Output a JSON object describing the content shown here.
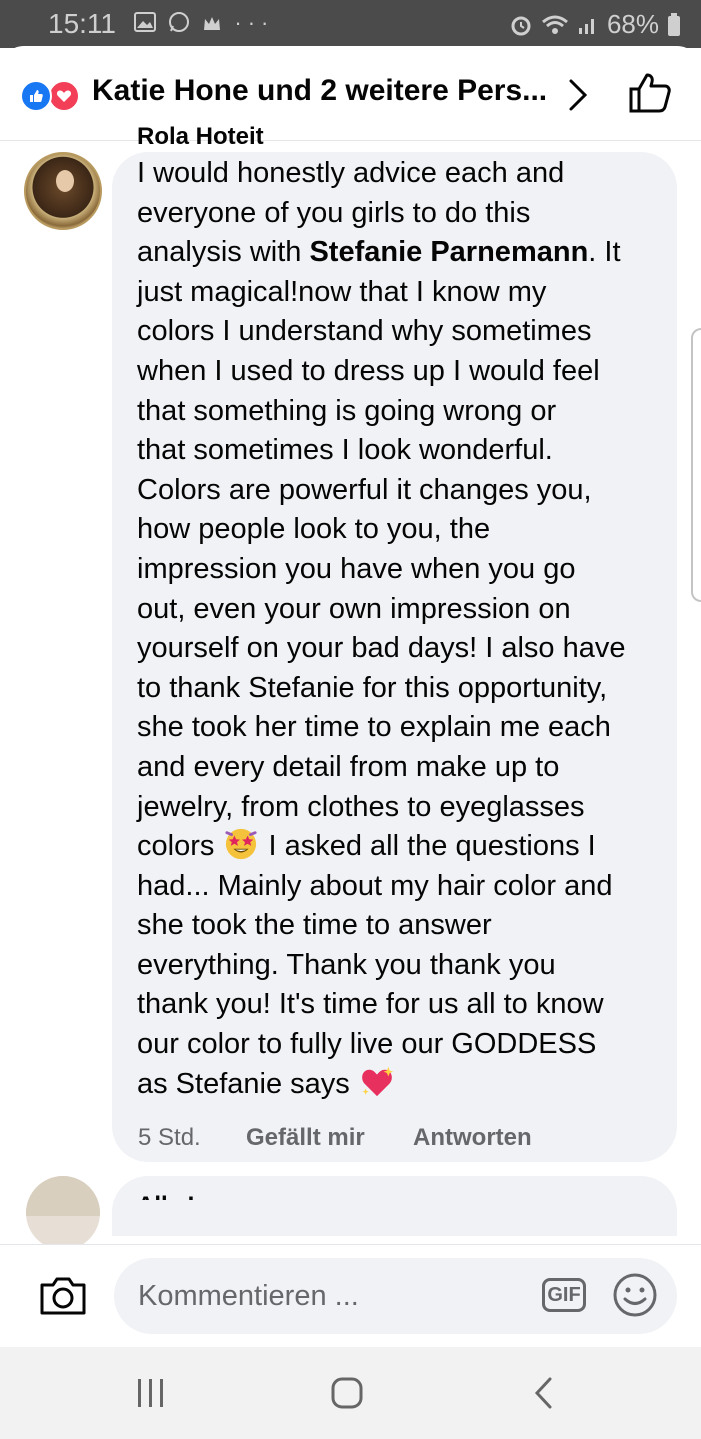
{
  "status_bar": {
    "time": "15:11",
    "left_icons": [
      "gallery-icon",
      "whatsapp-icon",
      "crown-icon",
      "more-icon"
    ],
    "battery": "68%"
  },
  "header": {
    "reactions": [
      "like",
      "love"
    ],
    "reactors_text": "Katie Hone und 2 weitere Pers...",
    "colors": {
      "like": "#1877f2",
      "love": "#f33e58"
    }
  },
  "comment": {
    "author": "Rola Hoteit",
    "lines": [
      "I would honestly advice each and",
      "everyone of you girls to do this",
      "analysis with ",
      "Stefanie Parnemann",
      ". It",
      "just magical!now that I know my",
      "colors I understand why sometimes",
      "when I used to dress up I would feel",
      "that something is going wrong or",
      "that sometimes I look wonderful.",
      "Colors are powerful it changes you,",
      "how people look to you, the",
      "impression you have when you go",
      "out, even your own impression on",
      "yourself on your bad days! I also have",
      "to thank Stefanie for this opportunity,",
      "she took her time to explain me each",
      "and every detail from make up to",
      "jewelry, from clothes to eyeglasses",
      "colors ",
      " I asked all the questions I",
      "had... Mainly about my hair color and",
      "she took the time to answer",
      "everything. Thank you thank you",
      "thank you! It's time for us all to know",
      "our color to fully live our GODDESS",
      "as Stefanie says "
    ],
    "emojis": [
      "star-struck-emoji",
      "sparkling-heart-emoji"
    ],
    "time": "5 Std.",
    "like_label": "Gefällt mir",
    "reply_label": "Antworten"
  },
  "next_comment": {
    "author_partial": "Alla   I"
  },
  "composer": {
    "placeholder": "Kommentieren ...",
    "gif_label": "GIF",
    "icons": [
      "camera-icon",
      "emoji-icon"
    ]
  },
  "nav_bar": {
    "icons": [
      "recents-icon",
      "home-icon",
      "back-icon"
    ]
  }
}
